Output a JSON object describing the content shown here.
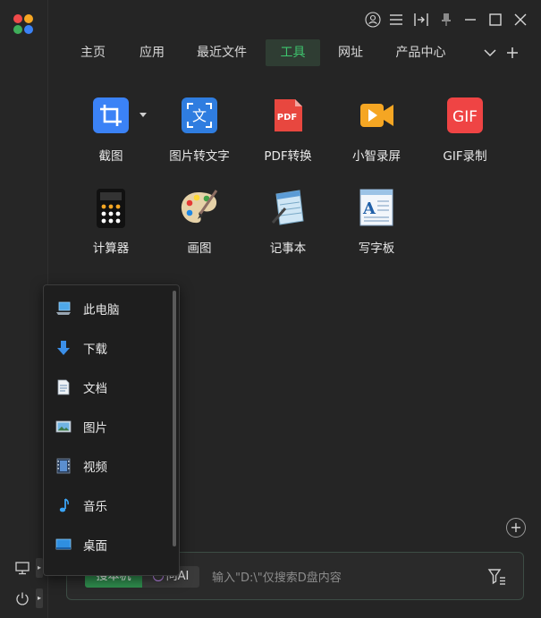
{
  "window": {
    "controls": [
      "user-icon",
      "menu-icon",
      "sidebar-toggle-icon",
      "pin-icon",
      "minimize-icon",
      "maximize-icon",
      "close-icon"
    ]
  },
  "tabs": [
    {
      "label": "主页"
    },
    {
      "label": "应用"
    },
    {
      "label": "最近文件"
    },
    {
      "label": "工具",
      "active": true
    },
    {
      "label": "网址"
    },
    {
      "label": "产品中心"
    }
  ],
  "tools": [
    {
      "label": "截图",
      "icon": "crop-icon"
    },
    {
      "label": "图片转文字",
      "icon": "image-to-text-icon"
    },
    {
      "label": "PDF转换",
      "icon": "pdf-icon",
      "badge": "PDF"
    },
    {
      "label": "小智录屏",
      "icon": "screen-record-icon"
    },
    {
      "label": "GIF录制",
      "icon": "gif-icon",
      "badge": "GIF"
    },
    {
      "label": "计算器",
      "icon": "calculator-icon"
    },
    {
      "label": "画图",
      "icon": "paint-palette-icon"
    },
    {
      "label": "记事本",
      "icon": "notepad-icon"
    },
    {
      "label": "写字板",
      "icon": "wordpad-icon"
    }
  ],
  "popup": {
    "items": [
      {
        "label": "此电脑",
        "icon": "computer-icon"
      },
      {
        "label": "下载",
        "icon": "download-icon"
      },
      {
        "label": "文档",
        "icon": "document-icon"
      },
      {
        "label": "图片",
        "icon": "picture-icon"
      },
      {
        "label": "视频",
        "icon": "video-icon"
      },
      {
        "label": "音乐",
        "icon": "music-icon"
      },
      {
        "label": "桌面",
        "icon": "desktop-icon"
      }
    ]
  },
  "search": {
    "local_label": "搜本机",
    "ai_label": "问AI",
    "placeholder": "输入\"D:\\\"仅搜索D盘内容"
  },
  "colors": {
    "accent": "#3ec46d",
    "active_tab_bg": "#2f3d33",
    "background": "#252525"
  }
}
